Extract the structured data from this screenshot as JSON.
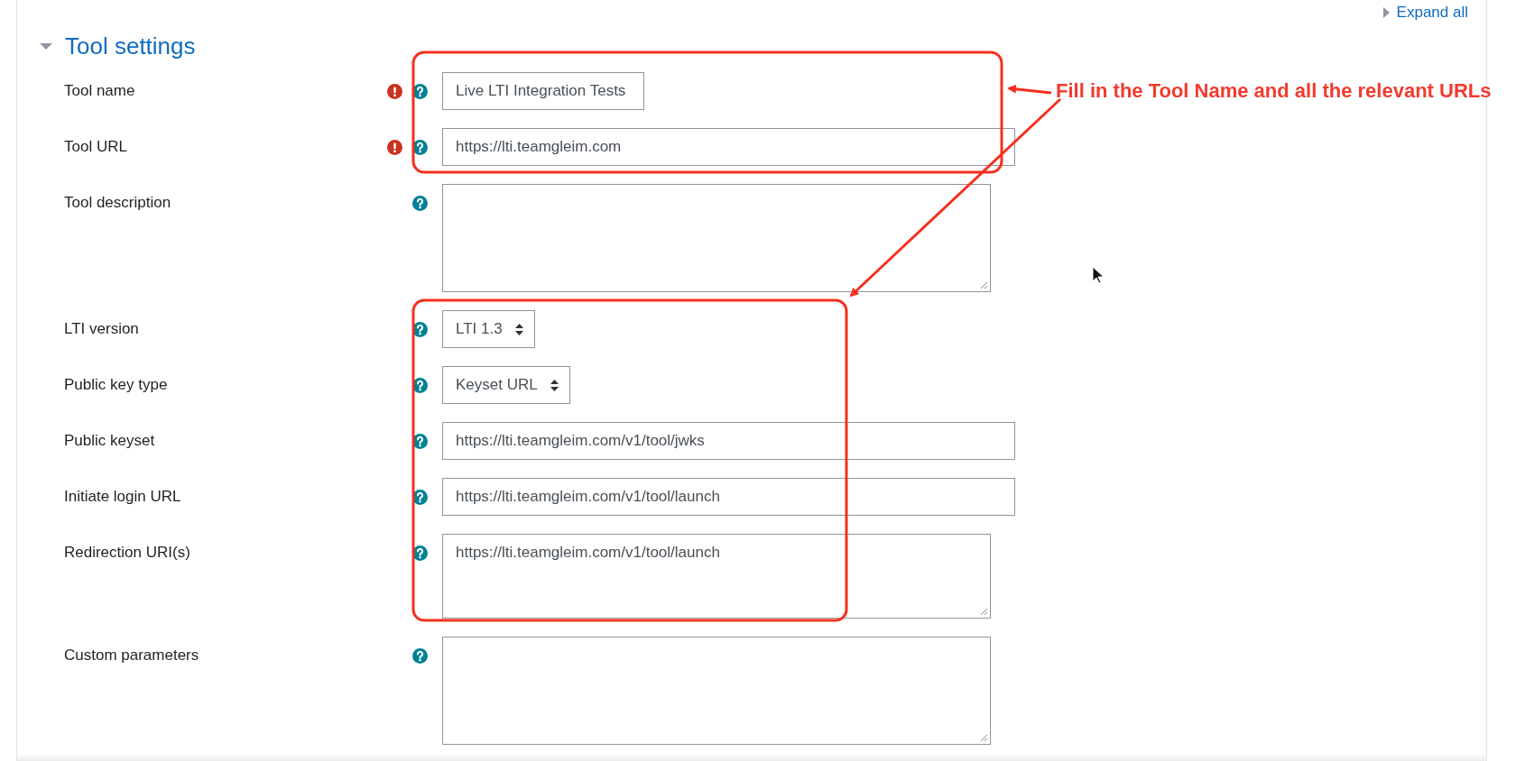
{
  "expand_all": "Expand all",
  "section": {
    "title": "Tool settings",
    "expanded": true
  },
  "fields": [
    {
      "label": "Tool name",
      "required": true,
      "kind": "short_text",
      "value": "Live LTI Integration Tests"
    },
    {
      "label": "Tool URL",
      "required": true,
      "kind": "text",
      "value": "https://lti.teamgleim.com"
    },
    {
      "label": "Tool description",
      "required": false,
      "kind": "textarea"
    },
    {
      "label": "LTI version",
      "required": false,
      "kind": "select",
      "value": "LTI 1.3"
    },
    {
      "label": "Public key type",
      "required": false,
      "kind": "select",
      "value": "Keyset URL"
    },
    {
      "label": "Public keyset",
      "required": false,
      "kind": "text",
      "value": "https://lti.teamgleim.com/v1/tool/jwks"
    },
    {
      "label": "Initiate login URL",
      "required": false,
      "kind": "text",
      "value": "https://lti.teamgleim.com/v1/tool/launch"
    },
    {
      "label": "Redirection URI(s)",
      "required": false,
      "kind": "textarea_short",
      "value": "https://lti.teamgleim.com/v1/tool/launch"
    },
    {
      "label": "Custom parameters",
      "required": false,
      "kind": "textarea"
    }
  ],
  "annotation": {
    "text": "Fill in the Tool Name and all the relevant URLs"
  }
}
